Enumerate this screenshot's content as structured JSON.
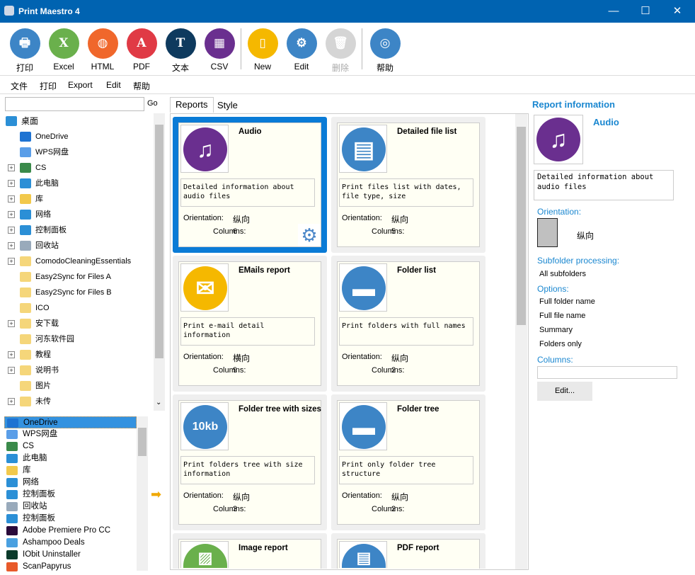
{
  "window": {
    "title": "Print Maestro 4",
    "minimize": "—",
    "maximize": "☐",
    "close": "✕"
  },
  "toolbar": [
    {
      "label": "打印",
      "icon": "printer-icon",
      "color": "#3d85c6",
      "glyph": "🖶"
    },
    {
      "label": "Excel",
      "icon": "excel-icon",
      "color": "#6ab04c",
      "glyph": "X"
    },
    {
      "label": "HTML",
      "icon": "html-icon",
      "color": "#f0672b",
      "glyph": "◍"
    },
    {
      "label": "PDF",
      "icon": "pdf-icon",
      "color": "#e03a45",
      "glyph": "A"
    },
    {
      "label": "文本",
      "icon": "text-icon",
      "color": "#0e3a5e",
      "glyph": "T"
    },
    {
      "label": "CSV",
      "icon": "csv-icon",
      "color": "#6a2f8f",
      "glyph": "▦"
    },
    {
      "label": "New",
      "icon": "new-document-icon",
      "color": "#f5b800",
      "glyph": "▯"
    },
    {
      "label": "Edit",
      "icon": "gear-icon",
      "color": "#3d85c6",
      "glyph": "⚙"
    },
    {
      "label": "删除",
      "icon": "trash-icon",
      "color": "#d5d5d5",
      "glyph": "🗑",
      "disabled": true
    },
    {
      "label": "帮助",
      "icon": "lifebuoy-icon",
      "color": "#3d85c6",
      "glyph": "◎"
    }
  ],
  "menu": [
    "文件",
    "打印",
    "Export",
    "Edit",
    "帮助"
  ],
  "search": {
    "value": "",
    "go": "Go"
  },
  "tree": [
    {
      "label": "桌面",
      "level": 0,
      "expander": false,
      "icon": "desktop-icon",
      "color": "#2b8fd6"
    },
    {
      "label": "OneDrive",
      "level": 1,
      "expander": false,
      "icon": "onedrive-icon",
      "color": "#1e73d2"
    },
    {
      "label": "WPS网盘",
      "level": 1,
      "expander": false,
      "icon": "cloud-icon",
      "color": "#5a9ee8"
    },
    {
      "label": "CS",
      "level": 1,
      "expander": true,
      "icon": "user-icon",
      "color": "#3a8a4a"
    },
    {
      "label": "此电脑",
      "level": 1,
      "expander": true,
      "icon": "computer-icon",
      "color": "#2b8fd6"
    },
    {
      "label": "库",
      "level": 1,
      "expander": true,
      "icon": "library-icon",
      "color": "#f2c94c"
    },
    {
      "label": "网络",
      "level": 1,
      "expander": true,
      "icon": "network-icon",
      "color": "#2b8fd6"
    },
    {
      "label": "控制面板",
      "level": 1,
      "expander": true,
      "icon": "control-panel-icon",
      "color": "#2b8fd6"
    },
    {
      "label": "回收站",
      "level": 1,
      "expander": true,
      "icon": "recycle-bin-icon",
      "color": "#9ab"
    },
    {
      "label": "ComodoCleaningEssentials",
      "level": 1,
      "expander": true,
      "icon": "folder-icon",
      "color": "#f5d67a"
    },
    {
      "label": "Easy2Sync for Files A",
      "level": 1,
      "expander": false,
      "icon": "folder-icon",
      "color": "#f5d67a"
    },
    {
      "label": "Easy2Sync for Files B",
      "level": 1,
      "expander": false,
      "icon": "folder-icon",
      "color": "#f5d67a"
    },
    {
      "label": "ICO",
      "level": 1,
      "expander": false,
      "icon": "folder-icon",
      "color": "#f5d67a"
    },
    {
      "label": "安下载",
      "level": 1,
      "expander": true,
      "icon": "folder-icon",
      "color": "#f5d67a"
    },
    {
      "label": "河东软件园",
      "level": 1,
      "expander": false,
      "icon": "folder-icon",
      "color": "#f5d67a"
    },
    {
      "label": "教程",
      "level": 1,
      "expander": true,
      "icon": "folder-icon",
      "color": "#f5d67a"
    },
    {
      "label": "说明书",
      "level": 1,
      "expander": true,
      "icon": "folder-icon",
      "color": "#f5d67a"
    },
    {
      "label": "图片",
      "level": 1,
      "expander": false,
      "icon": "folder-icon",
      "color": "#f5d67a"
    },
    {
      "label": "未传",
      "level": 1,
      "expander": true,
      "icon": "folder-icon",
      "color": "#f5d67a"
    }
  ],
  "list": [
    {
      "label": "OneDrive",
      "icon": "onedrive-icon",
      "color": "#1e73d2",
      "selected": true
    },
    {
      "label": "WPS网盘",
      "icon": "cloud-icon",
      "color": "#5a9ee8"
    },
    {
      "label": "CS",
      "icon": "user-icon",
      "color": "#3a8a4a"
    },
    {
      "label": "此电脑",
      "icon": "computer-icon",
      "color": "#2b8fd6"
    },
    {
      "label": "库",
      "icon": "library-icon",
      "color": "#f2c94c"
    },
    {
      "label": "网络",
      "icon": "network-icon",
      "color": "#2b8fd6"
    },
    {
      "label": "控制面板",
      "icon": "control-panel-icon",
      "color": "#2b8fd6"
    },
    {
      "label": "回收站",
      "icon": "recycle-bin-icon",
      "color": "#9ab"
    },
    {
      "label": "控制面板",
      "icon": "control-panel-icon",
      "color": "#2b8fd6"
    },
    {
      "label": "Adobe Premiere Pro CC",
      "icon": "premiere-icon",
      "color": "#2a0a3a"
    },
    {
      "label": "Ashampoo Deals",
      "icon": "ashampoo-icon",
      "color": "#4aa0e0"
    },
    {
      "label": "IObit Uninstaller",
      "icon": "iobit-icon",
      "color": "#0b3a2a"
    },
    {
      "label": "ScanPapyrus",
      "icon": "scanpapyrus-icon",
      "color": "#e85a2a"
    }
  ],
  "tabs": [
    "Reports",
    "Style"
  ],
  "cards": [
    {
      "name": "Audio",
      "desc": "Detailed information about audio files",
      "orientation": "纵向",
      "columns": "6",
      "icon": "music-note-icon",
      "color": "#6a2f8f",
      "glyph": "♫",
      "selected": true
    },
    {
      "name": "Detailed file list",
      "desc": "Print files list with dates, file type, size",
      "orientation": "纵向",
      "columns": "5",
      "icon": "document-list-icon",
      "color": "#3d85c6",
      "glyph": "▤"
    },
    {
      "name": "EMails report",
      "desc": "Print e-mail detail information",
      "orientation": "横向",
      "columns": "9",
      "icon": "envelope-icon",
      "color": "#f5b800",
      "glyph": "✉"
    },
    {
      "name": "Folder list",
      "desc": "Print folders with full names",
      "orientation": "纵向",
      "columns": "2",
      "icon": "folder-icon",
      "color": "#3d85c6",
      "glyph": "▬"
    },
    {
      "name": "Folder tree with sizes",
      "desc": "Print folders tree with size information",
      "orientation": "纵向",
      "columns": "3",
      "icon": "folder-size-icon",
      "color": "#3d85c6",
      "glyph": "10kb"
    },
    {
      "name": "Folder tree",
      "desc": "Print only folder tree structure",
      "orientation": "纵向",
      "columns": "2",
      "icon": "folder-tree-icon",
      "color": "#3d85c6",
      "glyph": "▬"
    },
    {
      "name": "Image report",
      "desc": "",
      "orientation": "",
      "columns": "",
      "icon": "image-icon",
      "color": "#6ab04c",
      "glyph": "▨"
    },
    {
      "name": "PDF report",
      "desc": "",
      "orientation": "",
      "columns": "",
      "icon": "pdf-document-icon",
      "color": "#3d85c6",
      "glyph": "▤"
    }
  ],
  "card_labels": {
    "orientation": "Orientation:",
    "columns": "Columns:"
  },
  "info": {
    "heading": "Report information",
    "name": "Audio",
    "desc": "Detailed information about audio files",
    "orientation_label": "Orientation:",
    "orientation": "纵向",
    "subfolder_label": "Subfolder processing:",
    "subfolder": "All subfolders",
    "options_label": "Options:",
    "options": [
      "Full folder name",
      "Full file name",
      "Summary",
      "Folders only"
    ],
    "columns_label": "Columns:",
    "columns_value": "",
    "edit": "Edit..."
  },
  "accent": "#0063b1"
}
